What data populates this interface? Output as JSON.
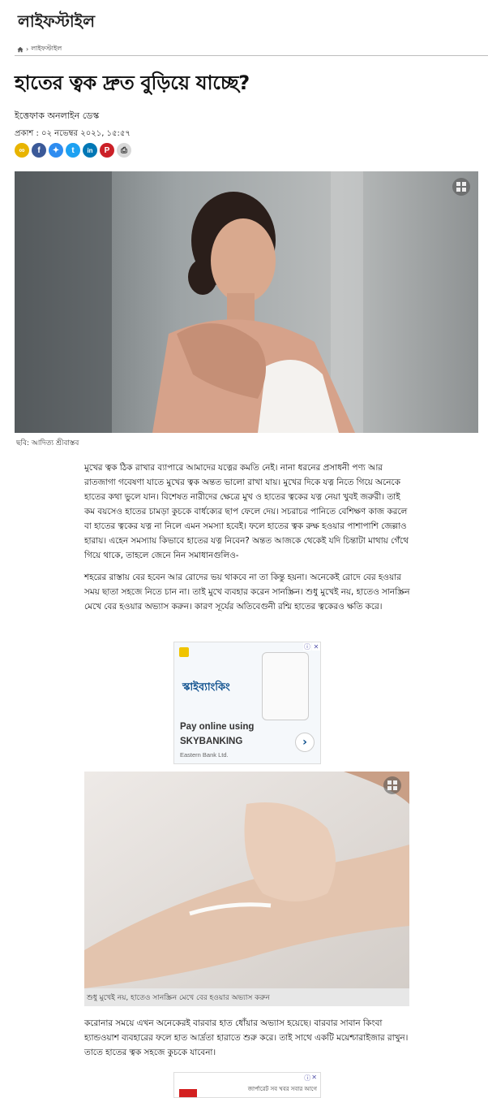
{
  "section": {
    "title": "লাইফস্টাইল"
  },
  "breadcrumb": {
    "separator": "›",
    "current": "লাইফস্টাইল"
  },
  "article": {
    "headline": "হাতের ত্বক দ্রুত বুড়িয়ে যাচ্ছে?",
    "author": "ইত্তেফাক অনলাইন ডেস্ক",
    "published": "প্রকাশ : ০২ নভেম্বর ২০২১, ১৫:৫৭",
    "hero_caption": "ছবি: আদিত্য শ্রীবাস্তব",
    "paragraphs": [
      "মুখের ত্বক ঠিক রাখার ব্যাপারে আমাদের যত্নের কমতি নেই। নানা ধরনের প্রসাধনী পণ্য আর রাতজাগা গবেষণা যাতে মুখের ত্বক অন্তত ভালো রাখা যায়। মুখের দিকে যত্ন নিতে গিয়ে অনেকে হাতের কথা ভুলে যান। বিশেষত নারীদের ক্ষেত্রে মুখ ও হাতের ত্বকের যত্ন নেয়া খুবই জরুরী। তাই কম বয়সেও হাতের চামড়া কুচকে বার্ধক্যের ছাপ ফেলে দেয়। সচরাচর পানিতে বেশিক্ষণ কাজ করলে বা হাতের ত্বকের যত্ন না নিলে এমন সমস্যা হবেই। ফলে হাতের ত্বক রুক্ষ হওয়ার পাশাপাশি জেল্লাও হারায়। এহেন সমস্যায় কিভাবে হাতের যত্ন নিবেন? অন্তত আজকে থেকেই যদি চিন্তাটা মাথায় গেঁথে গিয়ে থাকে, তাহলে জেনে নিন সমাধানগুলিও-",
      "শহরের রাস্তায় বের হবেন আর রোদের ভয় থাকবে না তা কিন্তু হয়না। অনেকেই রোদে বের হওয়ার সময় ছাতা সহজে নিতে চান না। তাই মুখে ব্যবহার করেন সানস্ক্রিন। শুধু মুখেই নয়, হাতেও সানস্ক্রিন মেখে বের হওয়ার অভ্যাস করুন। কারণ সূর্যের অতিবেগুনী রশ্মি হাতের ত্বকেরও ক্ষতি করে।",
      "করোনার সময়ে এখন অনেকেরই বারবার হাত ধোঁয়ার অভ্যাস হয়েছে। বারবার সাবান কিংবা হ্যান্ডওয়াশ ব্যবহারের ফলে হাত আর্দ্রতা হারাতে শুরু করে। তাই সাথে একটি ময়েশ্চারাইজার রাখুন। তাতে হাতের ত্বক সহজে কুচকে যাবেনা।"
    ],
    "image2_caption": "শুধু মুখেই নয়, হাতেও সানস্ক্রিন মেখে বের হওয়ার অভ্যাস করুন"
  },
  "share_buttons": [
    {
      "name": "copy-link-icon",
      "glyph": "∞",
      "color": "#e8b400"
    },
    {
      "name": "facebook-icon",
      "glyph": "f",
      "color": "#3b5998"
    },
    {
      "name": "messenger-icon",
      "glyph": "✦",
      "color": "#2e8cf0"
    },
    {
      "name": "twitter-icon",
      "glyph": "t",
      "color": "#1da1f2"
    },
    {
      "name": "linkedin-icon",
      "glyph": "in",
      "color": "#0077b5"
    },
    {
      "name": "pinterest-icon",
      "glyph": "P",
      "color": "#cb2027"
    },
    {
      "name": "print-icon",
      "glyph": "⎙",
      "color": "#d8d8d8"
    }
  ],
  "ad1": {
    "banner_text": "স্কাইব্যাংকিং",
    "line1": "Pay online using",
    "line2": "SKYBANKING",
    "brand": "Eastern Bank Ltd.",
    "arrow": "›"
  },
  "ad2": {
    "text": "জার্পারেট সব খবর সবার আগে"
  },
  "colors": {
    "ad_blue": "#0a4d8c",
    "caption_bg": "#e7e7e7"
  }
}
